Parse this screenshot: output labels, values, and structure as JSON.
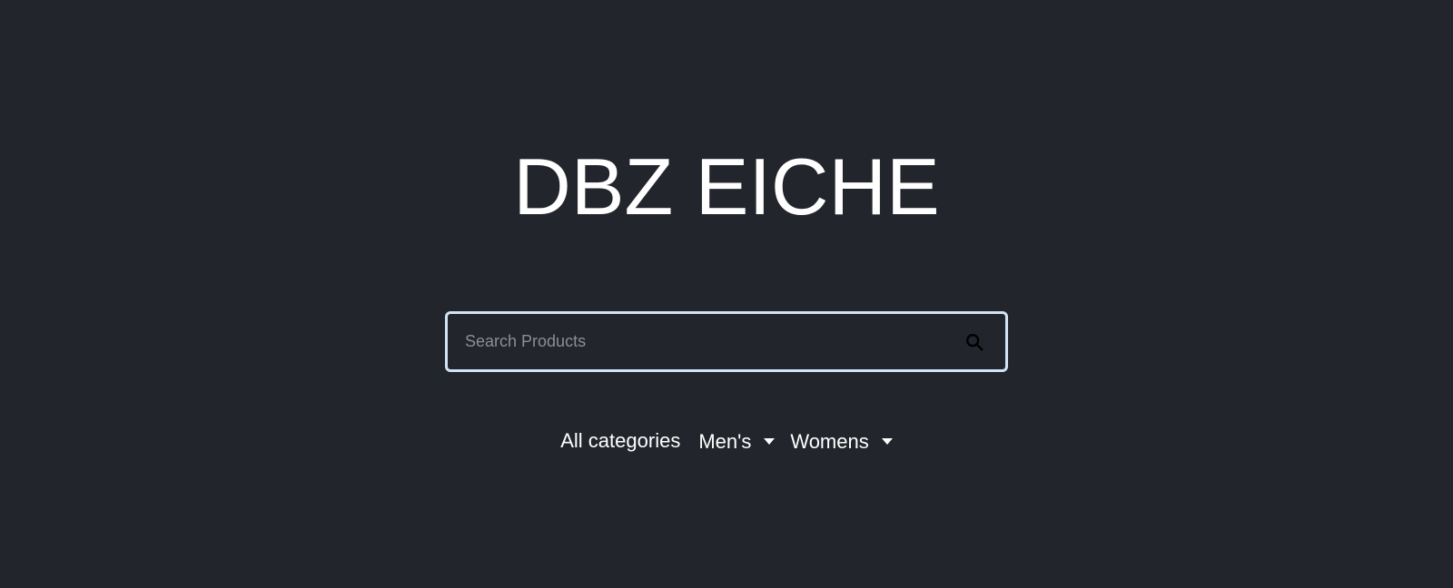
{
  "header": {
    "title": "DBZ EICHE"
  },
  "search": {
    "placeholder": "Search Products",
    "value": "",
    "button_icon": "search-icon"
  },
  "categories": {
    "items": [
      {
        "label": "All categories",
        "has_dropdown": false
      },
      {
        "label": "Men's",
        "has_dropdown": true,
        "icon": "caret-down-icon"
      },
      {
        "label": "Womens",
        "has_dropdown": true,
        "icon": "caret-down-icon"
      }
    ]
  },
  "colors": {
    "background": "#23252d",
    "text": "#ffffff",
    "search_border": "#d2e3f4",
    "placeholder": "#8b8e94",
    "search_icon": "#000000"
  }
}
